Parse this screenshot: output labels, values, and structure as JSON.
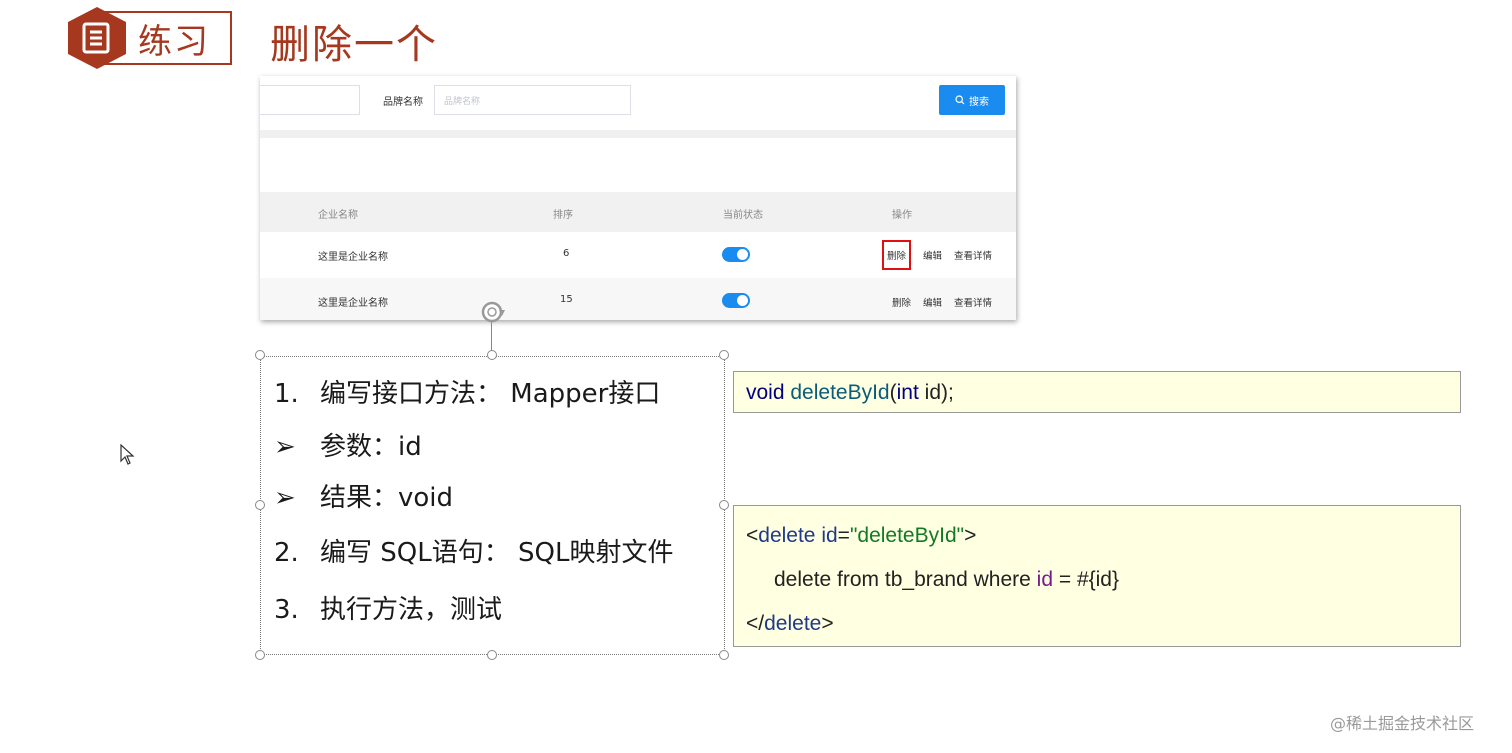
{
  "header": {
    "badge_label": "练习",
    "title": "删除一个"
  },
  "screenshot": {
    "brand_label": "品牌名称",
    "brand_placeholder": "品牌名称",
    "search_button_label": "搜索",
    "columns": [
      "企业名称",
      "排序",
      "当前状态",
      "操作"
    ],
    "rows": [
      {
        "company": "这里是企业名称",
        "order": "6",
        "status_on": true,
        "ops": [
          "删除",
          "编辑",
          "查看详情"
        ],
        "highlight_delete": true
      },
      {
        "company": "这里是企业名称",
        "order": "15",
        "status_on": true,
        "ops": [
          "删除",
          "编辑",
          "查看详情"
        ],
        "highlight_delete": false
      }
    ]
  },
  "steps": [
    {
      "marker": "1.",
      "text": "编写接口方法： Mapper接口"
    },
    {
      "marker": "➢",
      "text": "参数：id"
    },
    {
      "marker": "➢",
      "text": "结果：void"
    },
    {
      "marker": "2.",
      "text": "编写 SQL语句： SQL映射文件"
    },
    {
      "marker": "3.",
      "text": "执行方法，测试"
    }
  ],
  "code_interface": {
    "void": "void",
    "method": "deleteById",
    "open_paren": "(",
    "int": "int",
    "rest": " id);"
  },
  "code_xml": {
    "line1_lt": "<",
    "line1_tag": "delete",
    "line1_attr": " id",
    "line1_eq": "=",
    "line1_val": "\"deleteById\"",
    "line1_gt": ">",
    "line2_pre": "delete from tb_brand where ",
    "line2_id": "id",
    "line2_post": " = #{id}",
    "line3_lt": "</",
    "line3_tag": "delete",
    "line3_gt": ">"
  },
  "watermark": "@稀土掘金技术社区",
  "colors": {
    "accent_red": "#a6381f",
    "primary_blue": "#1a8cf0",
    "code_bg": "#ffffe2"
  }
}
